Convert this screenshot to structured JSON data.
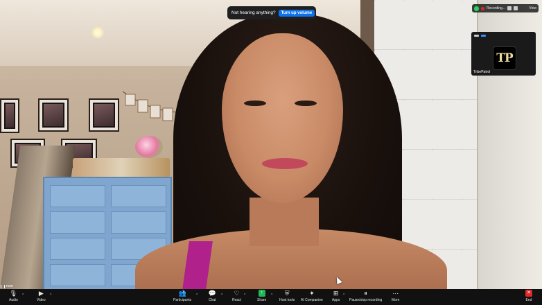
{
  "notification": {
    "message": "Not hearing anything?",
    "action_label": "Turn up volume",
    "close_glyph": "✕"
  },
  "recording": {
    "label": "Recording...",
    "view_label": "View"
  },
  "thumbnail": {
    "logo_text": "TP",
    "participant_name": "TribePatrol"
  },
  "self_view": {
    "name": "rose"
  },
  "toolbar": {
    "audio": {
      "label": "Audio",
      "icon": "microphone-icon"
    },
    "video": {
      "label": "Video",
      "icon": "video-camera-icon"
    },
    "participants": {
      "label": "Participants",
      "count": "2",
      "icon": "participants-icon"
    },
    "chat": {
      "label": "Chat",
      "icon": "chat-icon"
    },
    "react": {
      "label": "React",
      "icon": "heart-icon"
    },
    "share": {
      "label": "Share",
      "icon": "share-arrow-icon"
    },
    "host_tools": {
      "label": "Host tools",
      "icon": "shield-icon"
    },
    "ai_companion": {
      "label": "AI Companion",
      "icon": "sparkle-icon"
    },
    "apps": {
      "label": "Apps",
      "icon": "apps-icon"
    },
    "pause_stop": {
      "label": "Pause/stop recording",
      "icon": "pause-stop-icon"
    },
    "more": {
      "label": "More",
      "icon": "more-icon"
    },
    "end": {
      "label": "End",
      "icon": "end-icon"
    }
  },
  "colors": {
    "toolbar_bg": "#111111",
    "accent_blue": "#0e72ed",
    "share_green": "#1db954",
    "end_red": "#e02828",
    "recording_dot": "#e02828"
  }
}
